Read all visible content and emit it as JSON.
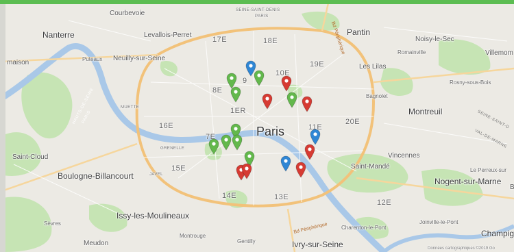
{
  "accent_color": "#5cbd52",
  "pin_colors": {
    "green": "#63b84c",
    "red": "#d63b33",
    "blue": "#2f86d4"
  },
  "labels": {
    "courbevoie": "Courbevoie",
    "nanterre": "Nanterre",
    "levallois": "Levallois-Perret",
    "maison": "maison",
    "puteaux": "Puteaux",
    "neuilly": "Neuilly-sur-Seine",
    "saint_denis_1": "SEINE-SAINT-DENIS",
    "saint_denis_2": "PARIS",
    "pantin": "Pantin",
    "noisy": "Noisy-le-Sec",
    "romainville": "Romainville",
    "villemomble": "Villemom",
    "les_lilas": "Les Lilas",
    "rosny": "Rosny-sous-Bois",
    "bagnolet": "Bagnolet",
    "montreuil": "Montreuil",
    "seine_saint_1": "SEINE-SAINT-D",
    "val_de_marne": "VAL-DE-MARNE",
    "paris": "Paris",
    "muette": "MUETTE",
    "hauts_de_seine": "HAUTS-DE-SEINE",
    "paris_small": "PARIS",
    "grenelle": "GRENELLE",
    "javel": "JAVEL",
    "saint_cloud": "Saint-Cloud",
    "vincennes": "Vincennes",
    "saint_mande": "Saint-Mandé",
    "perreux": "Le Perreux-sur",
    "nogent": "Nogent-sur-Marne",
    "boulogne": "Boulogne-Billancourt",
    "issy": "Issy-les-Moulineaux",
    "sevres": "Sèvres",
    "meudon": "Meudon",
    "montrouge": "Montrouge",
    "gentilly": "Gentilly",
    "ivry": "Ivry-sur-Seine",
    "charenton": "Charenton-le-Pont",
    "joinville": "Joinville-le-Pont",
    "champigny": "Champign",
    "bd_peripherique_1": "Bd Périphérique",
    "bd_peripherique_2": "Bd Périphérique",
    "b_edge": "B",
    "copyright": "Données cartographiques ©2019 Go"
  },
  "arrondissements": {
    "a17": "17E",
    "a18": "18E",
    "a19": "19E",
    "a10": "10E",
    "a9": "9",
    "a8": "8E",
    "a1": "1ER",
    "a16": "16E",
    "a7": "7E",
    "a11": "11E",
    "a20": "20E",
    "a15": "15E",
    "a14": "14E",
    "a13": "13E",
    "a12": "12E"
  },
  "pins": [
    {
      "color": "blue"
    },
    {
      "color": "green"
    },
    {
      "color": "green"
    },
    {
      "color": "green"
    },
    {
      "color": "red"
    },
    {
      "color": "red"
    },
    {
      "color": "green"
    },
    {
      "color": "red"
    },
    {
      "color": "green"
    },
    {
      "color": "green"
    },
    {
      "color": "green"
    },
    {
      "color": "green"
    },
    {
      "color": "blue"
    },
    {
      "color": "red"
    },
    {
      "color": "green"
    },
    {
      "color": "red"
    },
    {
      "color": "red"
    },
    {
      "color": "blue"
    },
    {
      "color": "red"
    }
  ]
}
